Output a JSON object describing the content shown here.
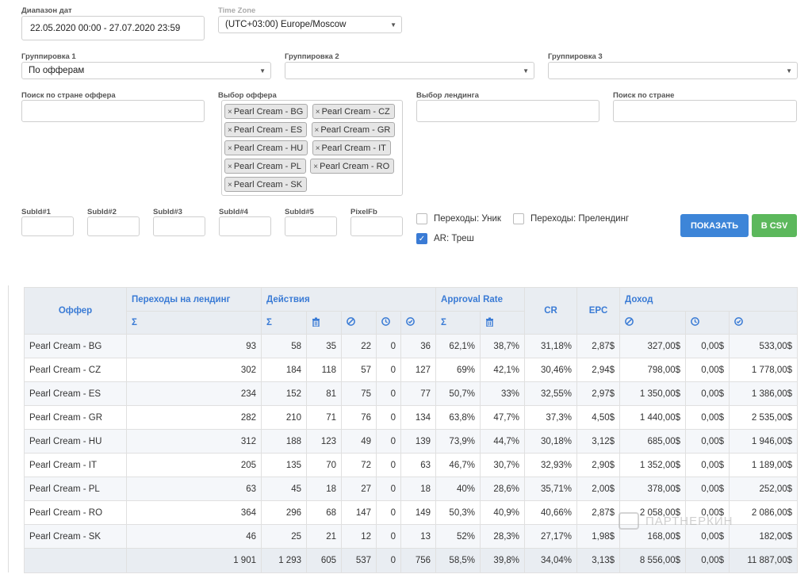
{
  "filters": {
    "date_range": {
      "label": "Диапазон дат",
      "value": "22.05.2020 00:00 - 27.07.2020 23:59"
    },
    "timezone": {
      "label": "Time Zone",
      "value": "(UTC+03:00) Europe/Moscow"
    },
    "group1": {
      "label": "Группировка 1",
      "value": "По офферам"
    },
    "group2": {
      "label": "Группировка 2",
      "value": ""
    },
    "group3": {
      "label": "Группировка 3",
      "value": ""
    },
    "offer_country_search": {
      "label": "Поиск по стране оффера",
      "value": ""
    },
    "offer_select": {
      "label": "Выбор оффера",
      "tags": [
        "Pearl Cream - BG",
        "Pearl Cream - CZ",
        "Pearl Cream - ES",
        "Pearl Cream - GR",
        "Pearl Cream - HU",
        "Pearl Cream - IT",
        "Pearl Cream - PL",
        "Pearl Cream - RO",
        "Pearl Cream - SK"
      ]
    },
    "landing_select": {
      "label": "Выбор лендинга",
      "value": ""
    },
    "country_search": {
      "label": "Поиск по стране",
      "value": ""
    },
    "subids": [
      "SubId#1",
      "SubId#2",
      "SubId#3",
      "SubId#4",
      "SubId#5",
      "PixelFb"
    ],
    "checkboxes": [
      {
        "label": "Переходы: Уник",
        "checked": false
      },
      {
        "label": "Переходы: Прелендинг",
        "checked": false
      },
      {
        "label": "AR: Треш",
        "checked": true
      }
    ],
    "show_button": "ПОКАЗАТЬ",
    "csv_button": "В CSV"
  },
  "table": {
    "headers": {
      "offer": "Оффер",
      "landing": "Переходы на лендинг",
      "actions": "Действия",
      "approval": "Approval Rate",
      "cr": "CR",
      "epc": "EPC",
      "income": "Доход"
    },
    "sigma": "Σ",
    "icons": {
      "trash": "trash-icon",
      "cancel": "cancel-icon",
      "clock": "clock-icon",
      "check": "check-icon"
    },
    "rows": [
      [
        "Pearl Cream - BG",
        "93",
        "58",
        "35",
        "22",
        "0",
        "36",
        "62,1%",
        "38,7%",
        "31,18%",
        "2,87$",
        "327,00$",
        "0,00$",
        "533,00$"
      ],
      [
        "Pearl Cream - CZ",
        "302",
        "184",
        "118",
        "57",
        "0",
        "127",
        "69%",
        "42,1%",
        "30,46%",
        "2,94$",
        "798,00$",
        "0,00$",
        "1 778,00$"
      ],
      [
        "Pearl Cream - ES",
        "234",
        "152",
        "81",
        "75",
        "0",
        "77",
        "50,7%",
        "33%",
        "32,55%",
        "2,97$",
        "1 350,00$",
        "0,00$",
        "1 386,00$"
      ],
      [
        "Pearl Cream - GR",
        "282",
        "210",
        "71",
        "76",
        "0",
        "134",
        "63,8%",
        "47,7%",
        "37,3%",
        "4,50$",
        "1 440,00$",
        "0,00$",
        "2 535,00$"
      ],
      [
        "Pearl Cream - HU",
        "312",
        "188",
        "123",
        "49",
        "0",
        "139",
        "73,9%",
        "44,7%",
        "30,18%",
        "3,12$",
        "685,00$",
        "0,00$",
        "1 946,00$"
      ],
      [
        "Pearl Cream - IT",
        "205",
        "135",
        "70",
        "72",
        "0",
        "63",
        "46,7%",
        "30,7%",
        "32,93%",
        "2,90$",
        "1 352,00$",
        "0,00$",
        "1 189,00$"
      ],
      [
        "Pearl Cream - PL",
        "63",
        "45",
        "18",
        "27",
        "0",
        "18",
        "40%",
        "28,6%",
        "35,71%",
        "2,00$",
        "378,00$",
        "0,00$",
        "252,00$"
      ],
      [
        "Pearl Cream - RO",
        "364",
        "296",
        "68",
        "147",
        "0",
        "149",
        "50,3%",
        "40,9%",
        "40,66%",
        "2,87$",
        "2 058,00$",
        "0,00$",
        "2 086,00$"
      ],
      [
        "Pearl Cream - SK",
        "46",
        "25",
        "21",
        "12",
        "0",
        "13",
        "52%",
        "28,3%",
        "27,17%",
        "1,98$",
        "168,00$",
        "0,00$",
        "182,00$"
      ]
    ],
    "totals": [
      "",
      "1 901",
      "1 293",
      "605",
      "537",
      "0",
      "756",
      "58,5%",
      "39,8%",
      "34,04%",
      "3,13$",
      "8 556,00$",
      "0,00$",
      "11 887,00$"
    ]
  },
  "watermark": "ПАРТНЕРКИН",
  "colors": {
    "accent": "#3a7bd5",
    "show_button": "#3d85d8",
    "csv_button": "#5cb85c",
    "header_bg": "#e9edf2"
  }
}
